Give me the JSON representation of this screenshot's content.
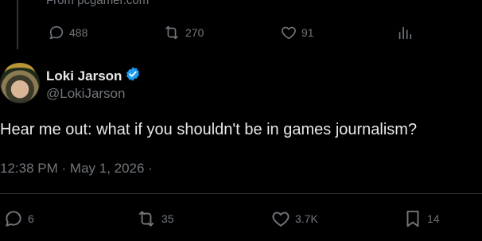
{
  "quoted": {
    "source_text": "From pcgamer.com",
    "replies": "488",
    "reposts": "270",
    "likes": "91"
  },
  "tweet": {
    "author_name": "Loki Jarson",
    "author_handle": "@LokiJarson",
    "text": "Hear me out: what if you shouldn't be in games journalism?",
    "time": "12:38 PM",
    "date": "May 1, 2026",
    "sep1": "·",
    "sep2": "·",
    "actions": {
      "replies": "6",
      "reposts": "35",
      "likes": "3.7K",
      "bookmarks": "14"
    }
  },
  "icons": {
    "verified": "verified-badge-icon",
    "reply": "reply-icon",
    "repost": "repost-icon",
    "like": "heart-icon",
    "views": "views-chart-icon",
    "bookmark": "bookmark-icon"
  },
  "colors": {
    "background": "#000000",
    "text": "#e7e9ea",
    "muted": "#71767b",
    "verified": "#1d9bf0",
    "divider": "#2f3336"
  }
}
